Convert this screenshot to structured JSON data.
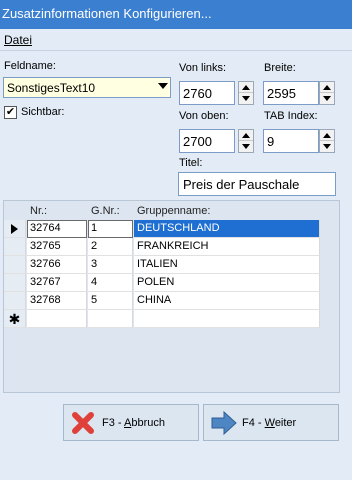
{
  "window": {
    "title": "Zusatzinformationen Konfigurieren..."
  },
  "menu": {
    "items": [
      {
        "label": "Datei"
      }
    ]
  },
  "form": {
    "feldname_label": "Feldname:",
    "feldname_value": "SonstigesText10",
    "sichtbar_label": "Sichtbar:",
    "sichtbar_checked": true,
    "von_links_label": "Von links:",
    "von_links_value": "2760",
    "breite_label": "Breite:",
    "breite_value": "2595",
    "von_oben_label": "Von oben:",
    "von_oben_value": "2700",
    "tab_index_label": "TAB Index:",
    "tab_index_value": "9",
    "titel_label": "Titel:",
    "titel_value": "Preis der Pauschale"
  },
  "grid": {
    "columns": [
      "Nr.:",
      "G.Nr.:",
      "Gruppenname:"
    ],
    "rows": [
      {
        "nr": "32764",
        "gnr": "1",
        "name": "DEUTSCHLAND",
        "selected": true
      },
      {
        "nr": "32765",
        "gnr": "2",
        "name": "FRANKREICH"
      },
      {
        "nr": "32766",
        "gnr": "3",
        "name": "ITALIEN"
      },
      {
        "nr": "32767",
        "gnr": "4",
        "name": "POLEN"
      },
      {
        "nr": "32768",
        "gnr": "5",
        "name": "CHINA"
      }
    ],
    "new_row_marker": "✱"
  },
  "buttons": {
    "abbruch_key": "F3 - ",
    "abbruch_letter": "A",
    "abbruch_rest": "bbruch",
    "weiter_key": "F4 - ",
    "weiter_letter": "W",
    "weiter_rest": "eiter"
  },
  "colors": {
    "titlebar": "#3b7fd1",
    "selection": "#1e6fd1",
    "cancel_icon": "#e0403a",
    "next_icon": "#4e86c4"
  }
}
